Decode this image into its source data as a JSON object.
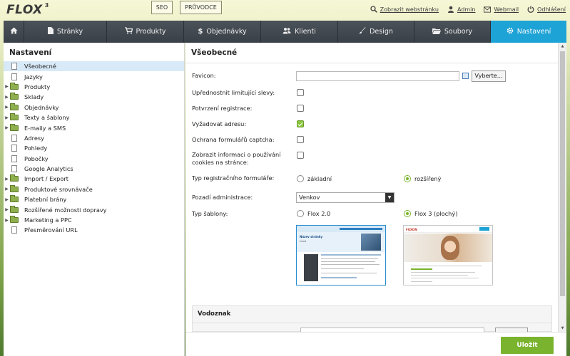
{
  "brand": {
    "logo": "FLOX",
    "version": "3"
  },
  "top_buttons": {
    "seo": "SEO",
    "guide": "PRŮVODCE"
  },
  "top_links": [
    {
      "label": "Zobrazit webstránku",
      "icon": "search-icon"
    },
    {
      "label": "Admin",
      "icon": "user-icon"
    },
    {
      "label": "Webmail",
      "icon": "mail-icon"
    },
    {
      "label": "Odhlášení",
      "icon": "power-icon"
    }
  ],
  "nav": {
    "home_icon": "home-icon",
    "items": [
      {
        "label": "Stránky",
        "icon": "page-icon"
      },
      {
        "label": "Produkty",
        "icon": "cart-icon"
      },
      {
        "label": "Objednávky",
        "icon": "dollar-icon"
      },
      {
        "label": "Klienti",
        "icon": "users-icon"
      },
      {
        "label": "Design",
        "icon": "brush-icon"
      },
      {
        "label": "Soubory",
        "icon": "folder-icon"
      },
      {
        "label": "Nastavení",
        "icon": "gear-icon"
      }
    ],
    "active": "Nastavení",
    "active_color": "#1ea3d6"
  },
  "sidebar": {
    "title": "Nastavení",
    "items": [
      {
        "label": "Všeobecné",
        "type": "file",
        "selected": true
      },
      {
        "label": "Jazyky",
        "type": "file"
      },
      {
        "label": "Produkty",
        "type": "folder"
      },
      {
        "label": "Sklady",
        "type": "folder"
      },
      {
        "label": "Objednávky",
        "type": "folder"
      },
      {
        "label": "Texty a šablony",
        "type": "folder"
      },
      {
        "label": "E-maily a SMS",
        "type": "folder"
      },
      {
        "label": "Adresy",
        "type": "file"
      },
      {
        "label": "Pohledy",
        "type": "file"
      },
      {
        "label": "Pobočky",
        "type": "file"
      },
      {
        "label": "Google Analytics",
        "type": "file"
      },
      {
        "label": "Import / Export",
        "type": "folder"
      },
      {
        "label": "Produktové srovnávače",
        "type": "folder"
      },
      {
        "label": "Platební brány",
        "type": "folder"
      },
      {
        "label": "Rozšířené možnosti dopravy",
        "type": "folder"
      },
      {
        "label": "Marketing a PPC",
        "type": "folder"
      },
      {
        "label": "Přesměrování URL",
        "type": "file"
      }
    ]
  },
  "main": {
    "title": "Všeobecné",
    "favicon": {
      "label": "Favicon:",
      "value": "",
      "choose_button": "Vyberte..."
    },
    "checkboxes": [
      {
        "label": "Upřednostnit limitující slevy:",
        "checked": false
      },
      {
        "label": "Potvrzení registrace:",
        "checked": false
      },
      {
        "label": "Vyžadovat adresu:",
        "checked": true
      },
      {
        "label": "Ochrana formulářů captcha:",
        "checked": false
      },
      {
        "label_line1": "Zobrazit informaci o používání",
        "label_line2": "cookies na stránce:",
        "checked": false
      }
    ],
    "registration_form": {
      "label": "Typ registračního formuláře:",
      "options": [
        "základní",
        "rozšířený"
      ],
      "selected": "rozšířený"
    },
    "admin_background": {
      "label": "Pozadí administrace:",
      "value": "Venkov"
    },
    "template_type": {
      "label": "Typ šablony:",
      "options": [
        "Flox 2.0",
        "Flox 3 (plochý)"
      ],
      "selected": "Flox 3 (plochý)"
    },
    "thumbnails": [
      {
        "header": "Název stránky",
        "sub": "Úvod"
      },
      {
        "logo": "FOXON"
      }
    ],
    "watermark": {
      "title": "Vodoznak"
    }
  },
  "footer": {
    "save_label": "Uložit",
    "save_color": "#7ab32e"
  }
}
